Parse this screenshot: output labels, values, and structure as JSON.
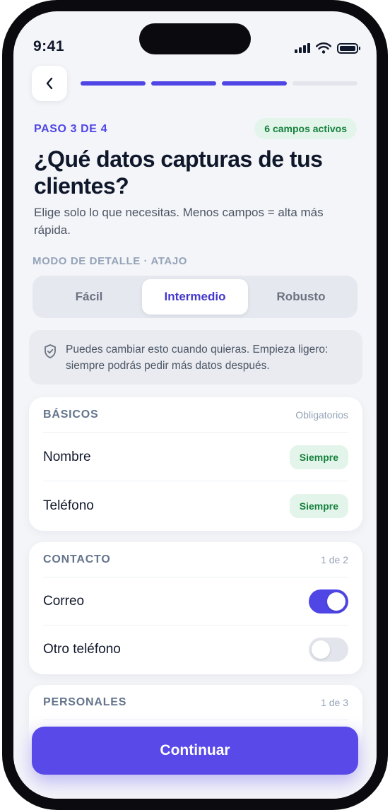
{
  "status_bar": {
    "time": "9:41"
  },
  "progress": {
    "total_steps": 4,
    "completed_steps": 3
  },
  "header": {
    "step_label": "PASO 3 DE 4",
    "active_fields_badge": "6 campos activos",
    "title": "¿Qué datos capturas de tus clientes?",
    "subtitle": "Elige solo lo que necesitas. Menos campos = alta más rápida."
  },
  "mode": {
    "label": "MODO DE DETALLE · ATAJO",
    "options": [
      "Fácil",
      "Intermedio",
      "Robusto"
    ],
    "selected": "Intermedio"
  },
  "notice": {
    "text": "Puedes cambiar esto cuando quieras. Empieza ligero: siempre podrás pedir más datos después."
  },
  "sections": {
    "basicos": {
      "title": "BÁSICOS",
      "meta": "Obligatorios",
      "rows": [
        {
          "label": "Nombre",
          "badge": "Siempre"
        },
        {
          "label": "Teléfono",
          "badge": "Siempre"
        }
      ]
    },
    "contacto": {
      "title": "CONTACTO",
      "meta": "1 de 2",
      "rows": [
        {
          "label": "Correo",
          "enabled": true
        },
        {
          "label": "Otro teléfono",
          "enabled": false
        }
      ]
    },
    "personales": {
      "title": "PERSONALES",
      "meta": "1 de 3"
    }
  },
  "cta": {
    "label": "Continuar"
  },
  "colors": {
    "accent": "#4f46e5",
    "success": "#15803d",
    "success_bg": "#e3f5ea",
    "background": "#f4f5f9"
  }
}
